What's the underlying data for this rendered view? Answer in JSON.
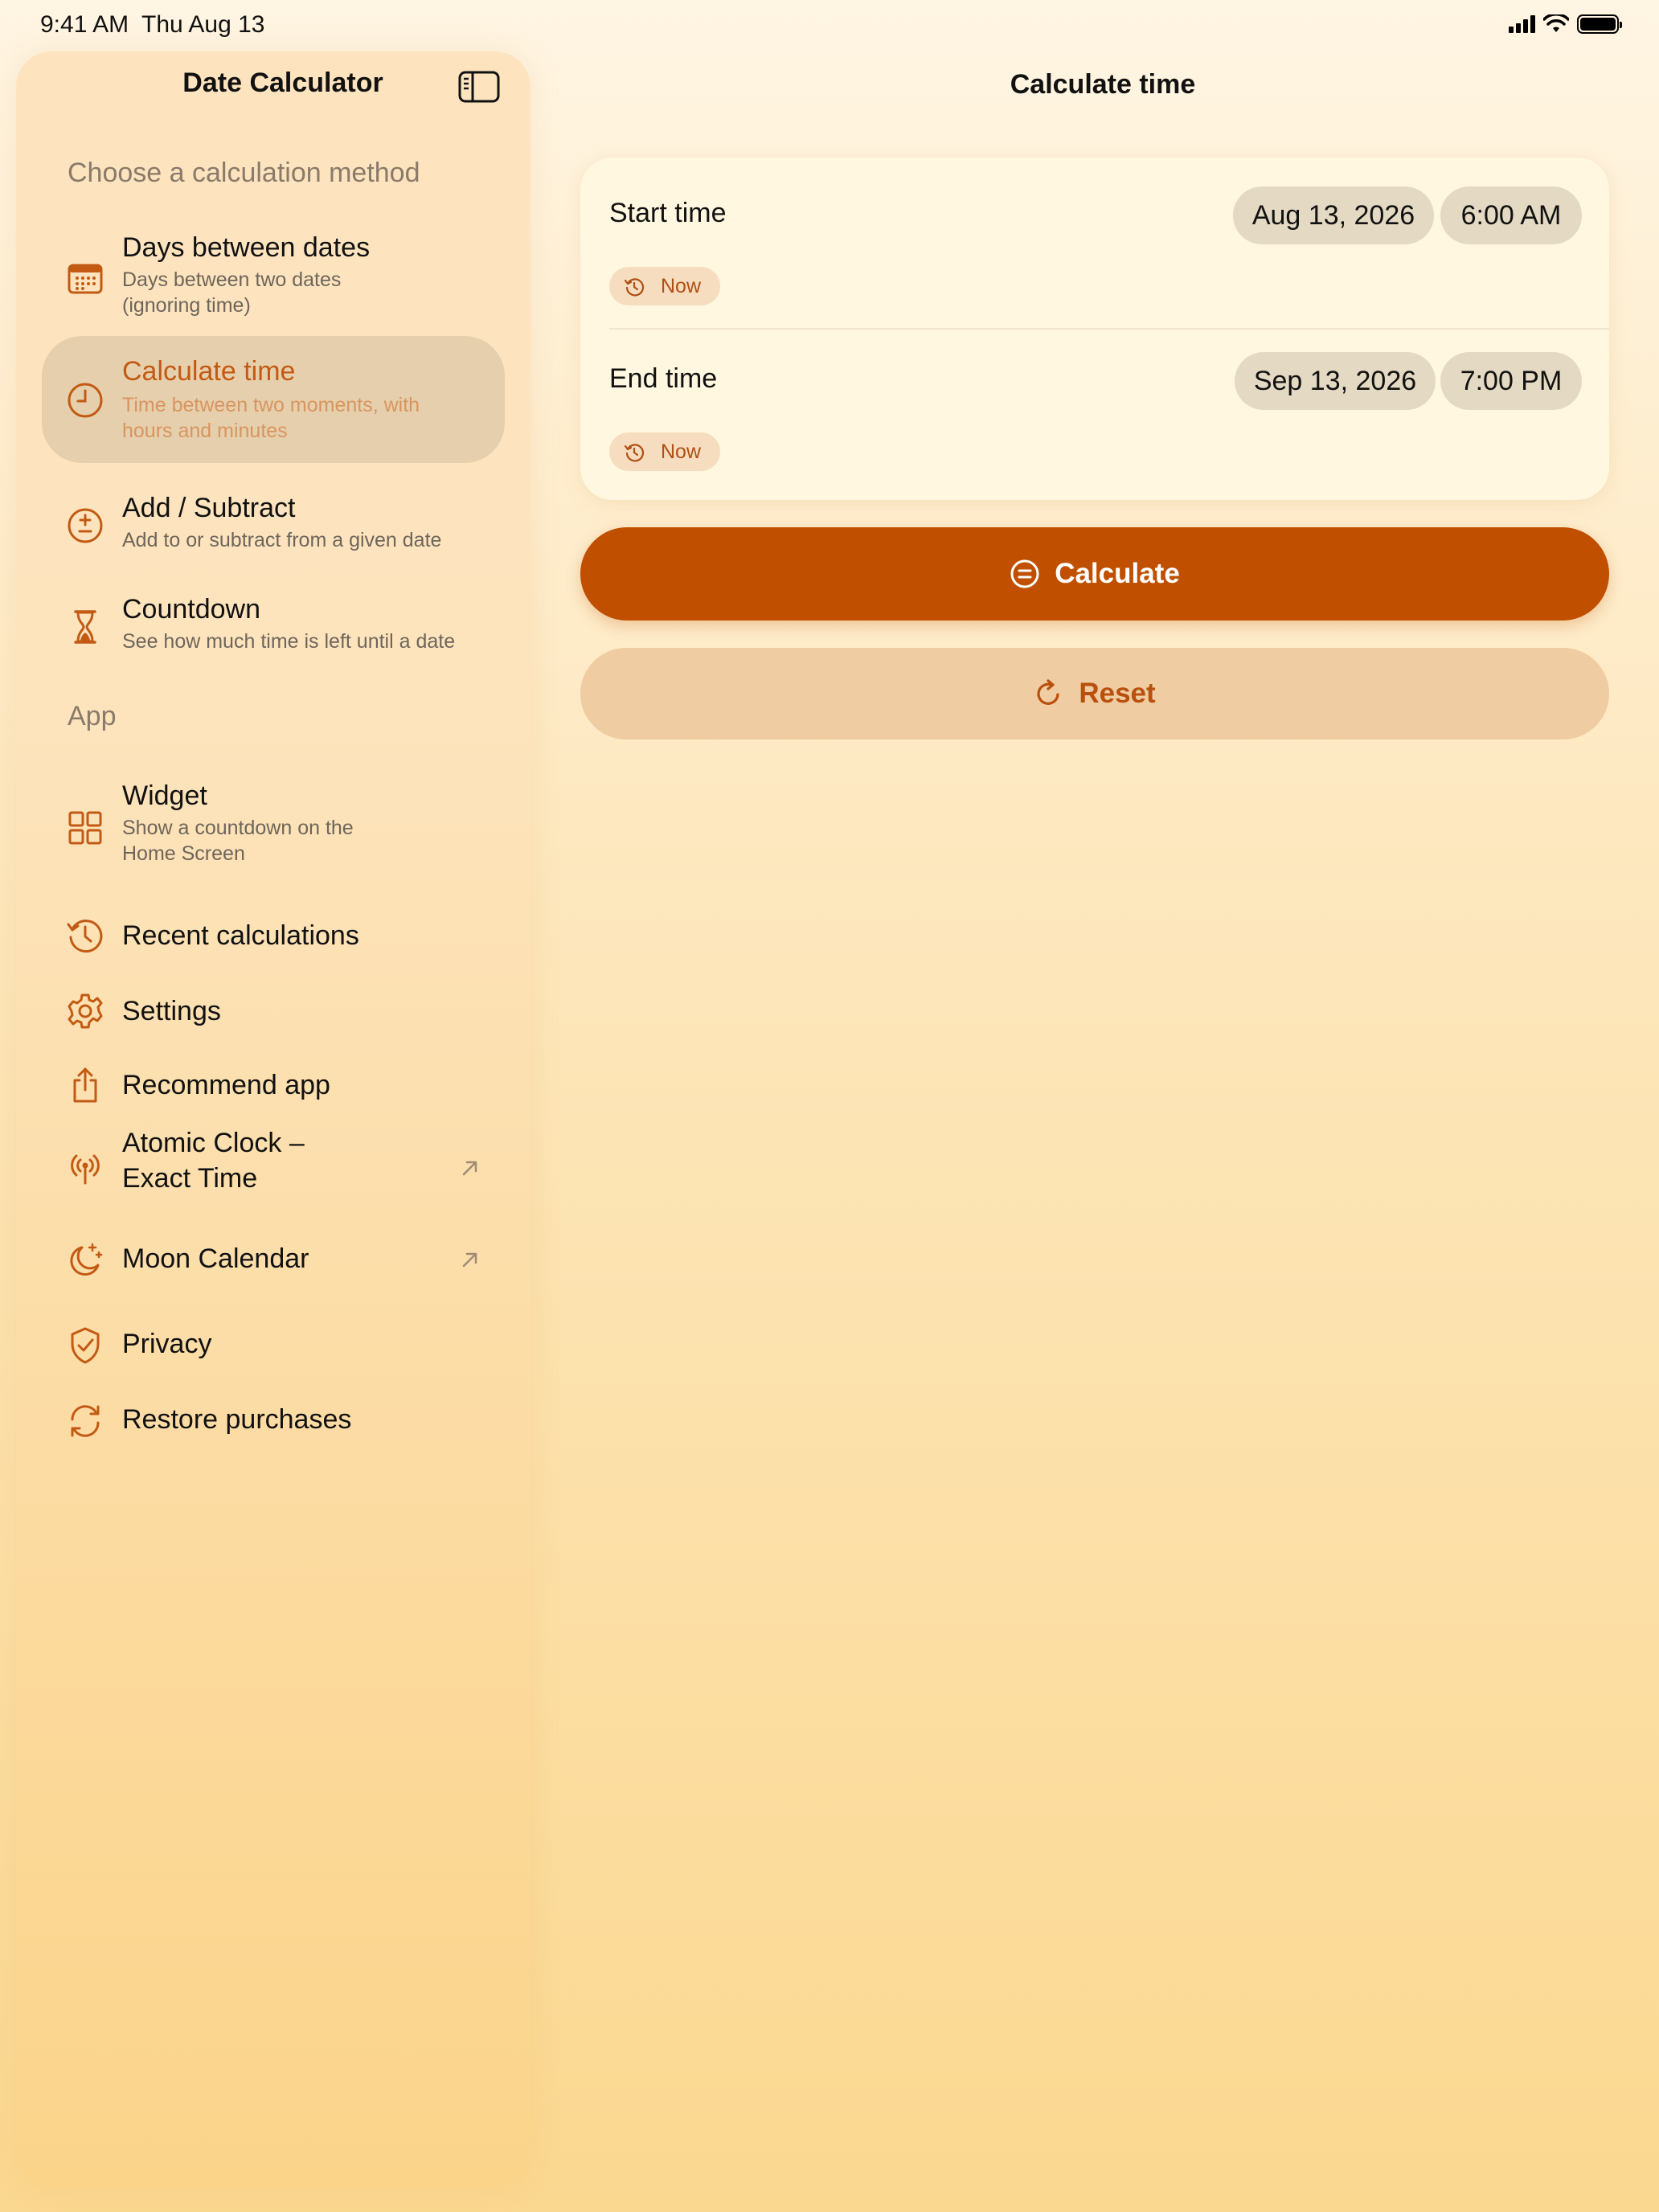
{
  "status_bar": {
    "time": "9:41 AM",
    "date": "Thu Aug 13"
  },
  "sidebar": {
    "title": "Date Calculator",
    "section_methods": "Choose a calculation method",
    "methods": [
      {
        "title": "Days between dates",
        "subtitle": "Days between two dates (ignoring time)",
        "icon": "calendar-icon"
      },
      {
        "title": "Calculate time",
        "subtitle": "Time between two moments, with hours and minutes",
        "icon": "clock-icon",
        "selected": true
      },
      {
        "title": "Add / Subtract",
        "subtitle": "Add to or subtract from a given date",
        "icon": "plus-minus-icon"
      },
      {
        "title": "Countdown",
        "subtitle": "See how much time is left until a date",
        "icon": "hourglass-icon"
      }
    ],
    "section_app": "App",
    "app_items": [
      {
        "title": "Widget",
        "subtitle": "Show a countdown on the Home Screen",
        "icon": "widget-grid-icon"
      },
      {
        "title": "Recent calculations",
        "icon": "history-icon"
      },
      {
        "title": "Settings",
        "icon": "gear-icon"
      },
      {
        "title": "Recommend app",
        "icon": "share-icon"
      },
      {
        "title": "Atomic Clock –\nExact Time",
        "icon": "antenna-icon",
        "external": true
      },
      {
        "title": "Moon Calendar",
        "icon": "moon-stars-icon",
        "external": true
      },
      {
        "title": "Privacy",
        "icon": "shield-check-icon"
      },
      {
        "title": "Restore purchases",
        "icon": "restore-arrows-icon"
      }
    ]
  },
  "main": {
    "title": "Calculate time",
    "start": {
      "label": "Start time",
      "date": "Aug 13, 2026",
      "time": "6:00 AM",
      "now_label": "Now"
    },
    "end": {
      "label": "End time",
      "date": "Sep 13, 2026",
      "time": "7:00 PM",
      "now_label": "Now"
    },
    "calculate_label": "Calculate",
    "reset_label": "Reset"
  },
  "colors": {
    "accent": "#c05000",
    "accent_soft": "#efcca1",
    "selected_bg": "#ddd0bb"
  }
}
